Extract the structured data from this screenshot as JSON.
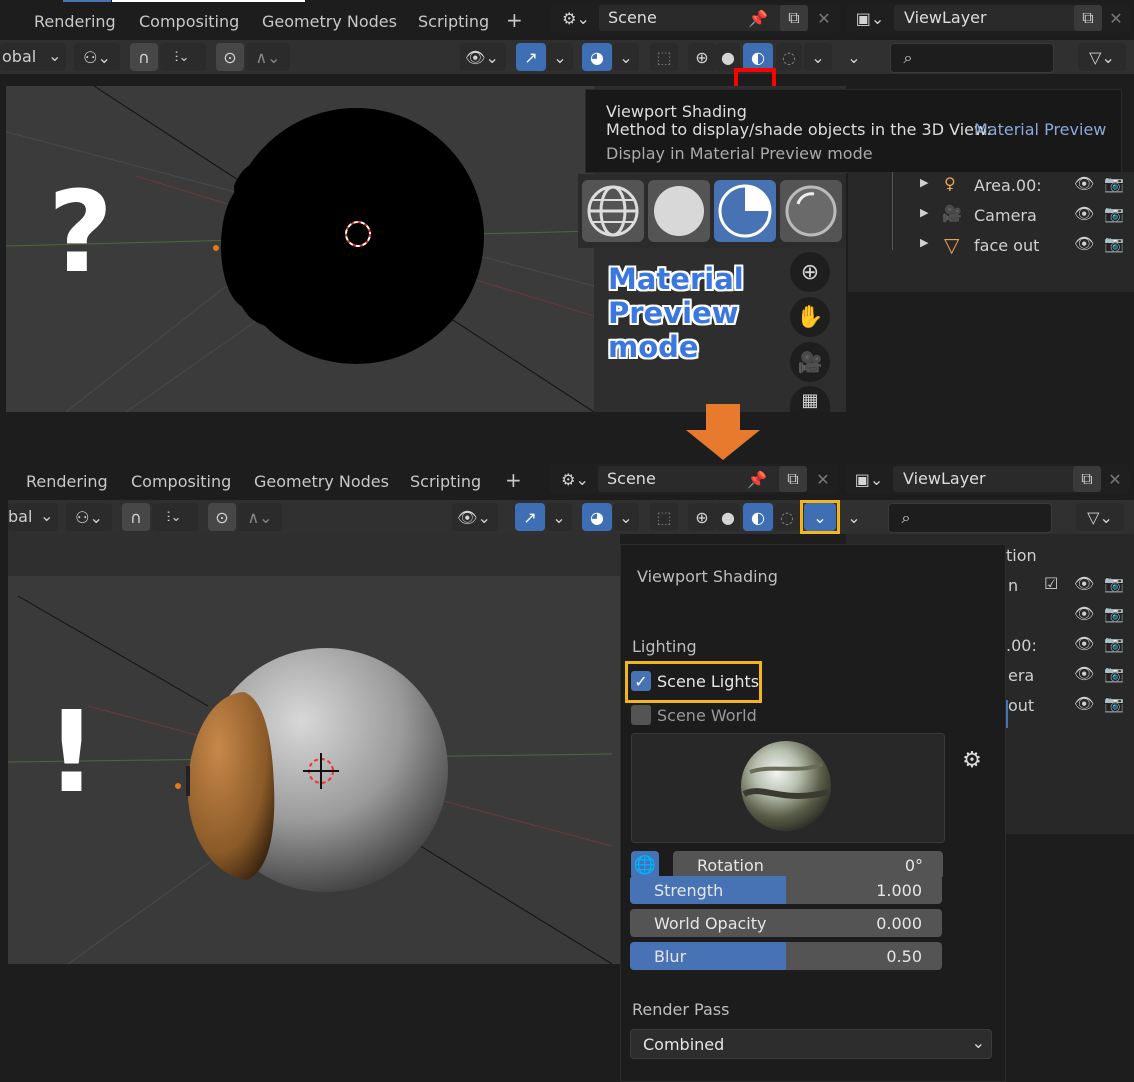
{
  "top": {
    "tabs": [
      "Rendering",
      "Compositing",
      "Geometry Nodes",
      "Scripting"
    ],
    "add_tab": "+",
    "scene_name": "Scene",
    "view_layer": "ViewLayer",
    "orientation_partial": "obal",
    "tooltip": {
      "title": "Viewport Shading",
      "line2_prefix": "Method to display/shade objects in the 3D View:",
      "line2_value": "Material Preview",
      "line3": "Display in Material Preview mode"
    },
    "annotation": [
      "Material",
      "Preview",
      "mode"
    ],
    "question_mark": "?",
    "outliner": [
      {
        "name": "Area.00:",
        "icon": "light-icon"
      },
      {
        "name": "Camera",
        "icon": "camera-icon"
      },
      {
        "name": "face out",
        "icon": "mesh-icon"
      }
    ]
  },
  "bottom": {
    "tabs": [
      "Rendering",
      "Compositing",
      "Geometry Nodes",
      "Scripting"
    ],
    "add_tab": "+",
    "scene_name": "Scene",
    "view_layer": "ViewLayer",
    "orientation_partial": "bal",
    "exclamation": "!",
    "panel": {
      "title": "Viewport Shading",
      "lighting_label": "Lighting",
      "scene_lights": "Scene Lights",
      "scene_lights_checked": true,
      "scene_world": "Scene World",
      "scene_world_checked": false,
      "rotation_label": "Rotation",
      "rotation_value": "0°",
      "strength_label": "Strength",
      "strength_value": "1.000",
      "strength_fill": 0.5,
      "opacity_label": "World Opacity",
      "opacity_value": "0.000",
      "blur_label": "Blur",
      "blur_value": "0.50",
      "blur_fill": 0.5,
      "render_pass_label": "Render Pass",
      "render_pass_value": "Combined"
    },
    "outliner_partial": [
      "tion",
      "n",
      ".00:",
      "era",
      "out"
    ]
  },
  "colors": {
    "highlight_red": "#ff0000",
    "highlight_yellow": "#f2b51d",
    "accent_blue": "#4772b3",
    "arrow_orange": "#e87a2e"
  }
}
